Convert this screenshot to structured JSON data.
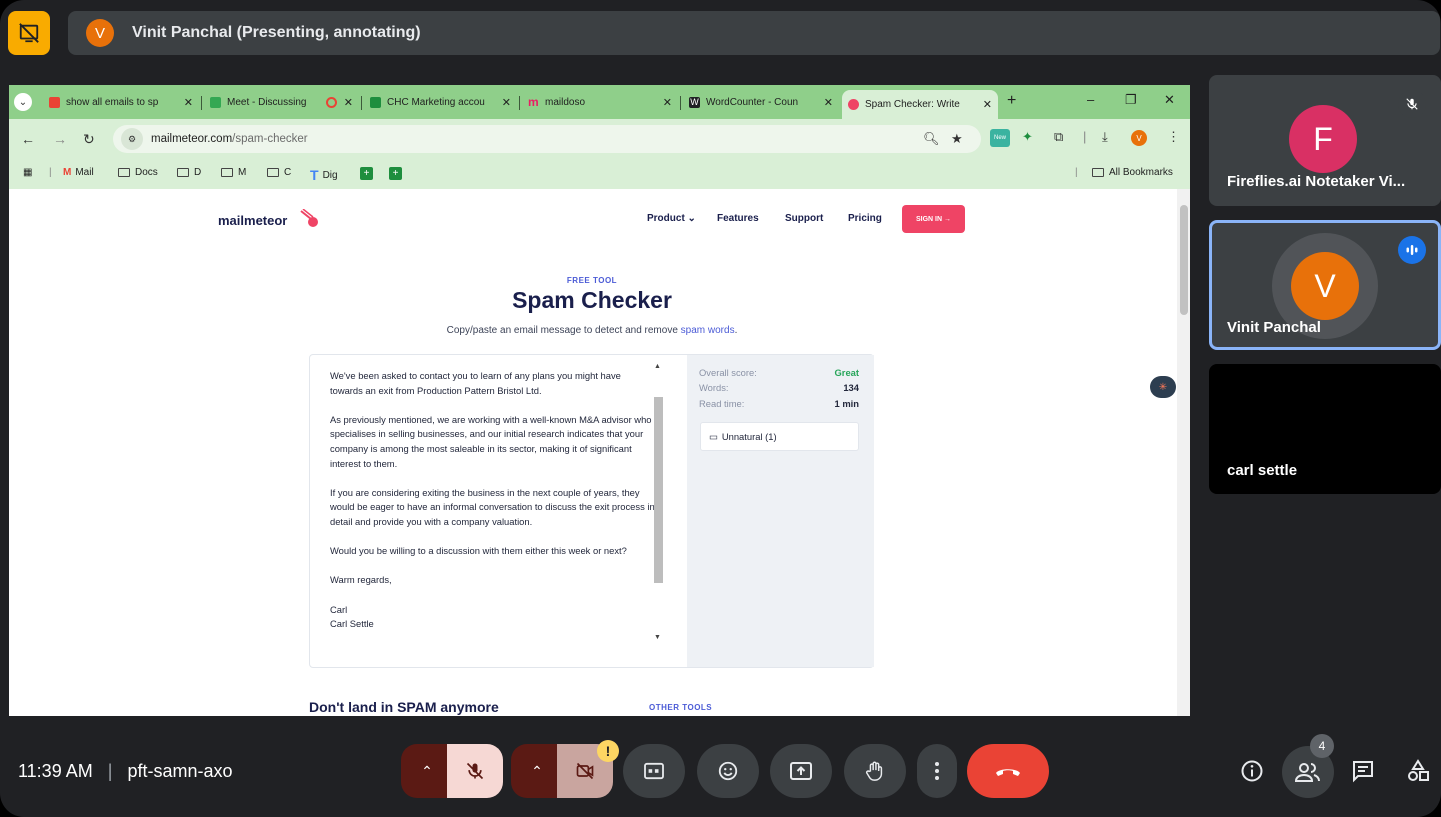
{
  "presenter": {
    "avatar_letter": "V",
    "status_text": "Vinit Panchal (Presenting, annotating)"
  },
  "browser": {
    "tabs": [
      {
        "title": "show all emails to sp",
        "favicon_color": "#ea4335"
      },
      {
        "title": "Meet - Discussing",
        "favicon_color": "#34a853"
      },
      {
        "title": "CHC Marketing accou",
        "favicon_color": "#1e8e3e"
      },
      {
        "title": "maildoso",
        "favicon_color": "#e91e63"
      },
      {
        "title": "WordCounter - Coun",
        "favicon_color": "#202124"
      },
      {
        "title": "Spam Checker: Write",
        "favicon_color": "#ef4465"
      }
    ],
    "url_host": "mailmeteor.com",
    "url_path": "/spam-checker",
    "bookmarks": [
      "Mail",
      "Docs",
      "D",
      "M",
      "C",
      "Dig"
    ],
    "all_bookmarks": "All Bookmarks",
    "ext_badge": "New",
    "profile_letter": "V"
  },
  "site": {
    "logo": "mailmeteor",
    "nav": [
      "Product ⌄",
      "Features",
      "Support",
      "Pricing"
    ],
    "signin": "SIGN IN →",
    "eyebrow": "FREE TOOL",
    "title": "Spam Checker",
    "subtitle_prefix": "Copy/paste an email message to detect and remove ",
    "subtitle_link": "spam words",
    "subtitle_suffix": ".",
    "email_paragraphs": [
      "We've been asked to contact you to learn of any plans you might have towards an exit from Production Pattern Bristol Ltd.",
      "As previously mentioned, we are working with a well-known M&A advisor who specialises in selling businesses, and our initial research indicates that your company is among the most saleable in its sector, making it of significant interest to them.",
      "If you are considering exiting the business in the next couple of years, they would be eager to have an informal conversation to discuss the exit process in detail and provide you with a company valuation.",
      "Would you be willing to a discussion with them either this week or next?",
      "Warm regards,",
      "Carl",
      "Carl Settle"
    ],
    "stats": {
      "score_label": "Overall score:",
      "score_value": "Great",
      "words_label": "Words:",
      "words_value": "134",
      "read_label": "Read time:",
      "read_value": "1 min"
    },
    "unnatural": "Unnatural (1)",
    "section_heading": "Don't land in SPAM anymore",
    "other_tools": "OTHER TOOLS"
  },
  "participants": [
    {
      "name": "Fireflies.ai Notetaker Vi...",
      "letter": "F",
      "color": "#d93064"
    },
    {
      "name": "Vinit Panchal",
      "letter": "V",
      "color": "#e8710a"
    },
    {
      "name": "carl settle"
    }
  ],
  "bottom": {
    "time": "11:39 AM",
    "separator": "|",
    "meeting_code": "pft-samn-axo",
    "people_count": "4",
    "camera_warning": "!"
  },
  "colors": {
    "accent_orange": "#f9ab00",
    "end_call": "#ea4335",
    "mic_off_bg": "#f6d8d4",
    "speaking_border": "#8ab4f8"
  }
}
